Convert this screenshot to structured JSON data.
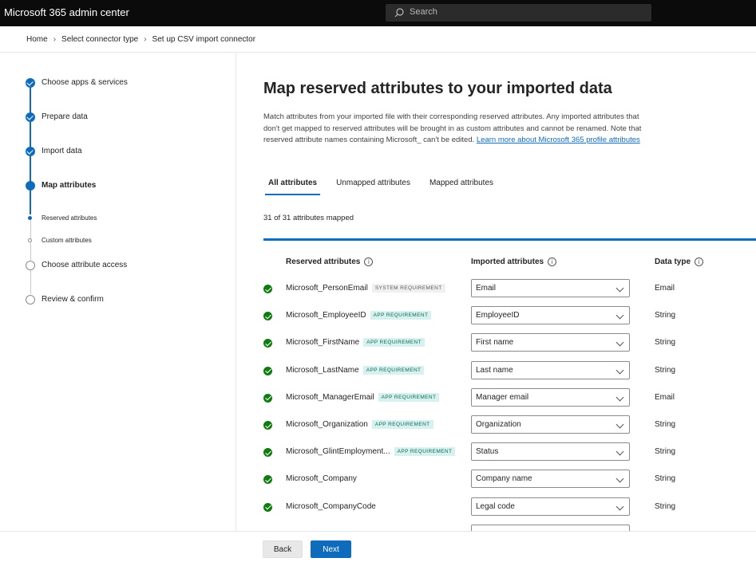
{
  "app": {
    "title": "Microsoft 365 admin center"
  },
  "search": {
    "placeholder": "Search"
  },
  "breadcrumb": [
    "Home",
    "Select connector type",
    "Set up CSV import connector"
  ],
  "steps": [
    {
      "label": "Choose apps & services",
      "state": "done"
    },
    {
      "label": "Prepare data",
      "state": "done"
    },
    {
      "label": "Import data",
      "state": "done"
    },
    {
      "label": "Map attributes",
      "state": "current"
    },
    {
      "label": "Choose attribute access",
      "state": "todo"
    },
    {
      "label": "Review & confirm",
      "state": "todo"
    }
  ],
  "substeps": [
    {
      "label": "Reserved attributes",
      "state": "active"
    },
    {
      "label": "Custom attributes",
      "state": "todo"
    }
  ],
  "main": {
    "title": "Map reserved attributes to your imported data",
    "description": "Match attributes from your imported file with their corresponding reserved attributes. Any imported attributes that don't get mapped to reserved attributes will be brought in as custom attributes and cannot be renamed. Note that reserved attribute names containing Microsoft_ can't be edited.",
    "learn_more": "Learn more about Microsoft 365 profile attributes",
    "tabs": [
      "All attributes",
      "Unmapped attributes",
      "Mapped attributes"
    ],
    "active_tab": "All attributes",
    "mapped_count": "31 of 31 attributes mapped",
    "columns": {
      "reserved": "Reserved attributes",
      "imported": "Imported attributes",
      "type": "Data type"
    },
    "rows": [
      {
        "name": "Microsoft_PersonEmail",
        "badge": "SYSTEM REQUIREMENT",
        "badge_kind": "sys",
        "imported": "Email",
        "type": "Email"
      },
      {
        "name": "Microsoft_EmployeeID",
        "badge": "APP REQUIREMENT",
        "badge_kind": "app",
        "imported": "EmployeeID",
        "type": "String"
      },
      {
        "name": "Microsoft_FirstName",
        "badge": "APP REQUIREMENT",
        "badge_kind": "app",
        "imported": "First name",
        "type": "String"
      },
      {
        "name": "Microsoft_LastName",
        "badge": "APP REQUIREMENT",
        "badge_kind": "app",
        "imported": "Last name",
        "type": "String"
      },
      {
        "name": "Microsoft_ManagerEmail",
        "badge": "APP REQUIREMENT",
        "badge_kind": "app",
        "imported": "Manager email",
        "type": "Email"
      },
      {
        "name": "Microsoft_Organization",
        "badge": "APP REQUIREMENT",
        "badge_kind": "app",
        "imported": "Organization",
        "type": "String"
      },
      {
        "name": "Microsoft_GlintEmployment...",
        "badge": "APP REQUIREMENT",
        "badge_kind": "app",
        "imported": "Status",
        "type": "String"
      },
      {
        "name": "Microsoft_Company",
        "badge": "",
        "badge_kind": "",
        "imported": "Company name",
        "type": "String"
      },
      {
        "name": "Microsoft_CompanyCode",
        "badge": "",
        "badge_kind": "",
        "imported": "Legal code",
        "type": "String"
      }
    ]
  },
  "footer": {
    "back_label": "Back",
    "next_label": "Next"
  },
  "colors": {
    "accent": "#0f6cbd",
    "success": "#107c10",
    "topbar": "#0b0b0b"
  }
}
